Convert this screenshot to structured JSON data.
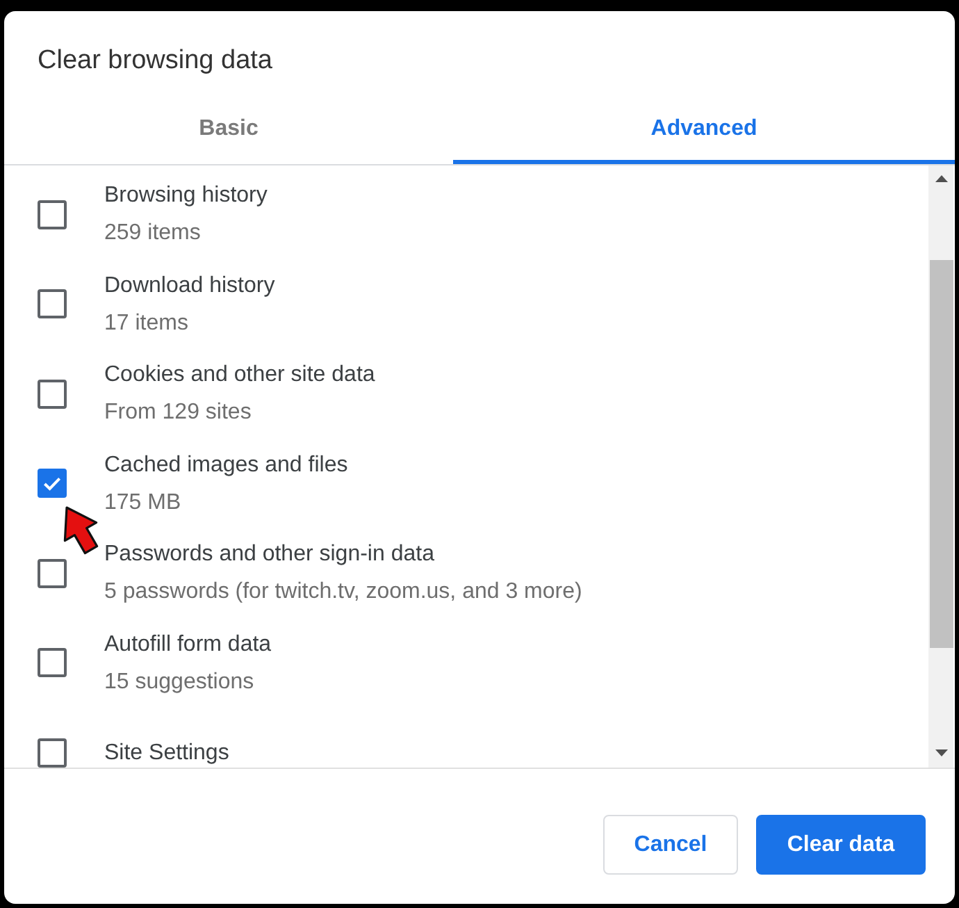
{
  "dialog": {
    "title": "Clear browsing data"
  },
  "tabs": [
    {
      "label": "Basic",
      "selected": false
    },
    {
      "label": "Advanced",
      "selected": true
    }
  ],
  "items": [
    {
      "label": "Browsing history",
      "detail": "259 items",
      "checked": false,
      "arrow_pointer": false
    },
    {
      "label": "Download history",
      "detail": "17 items",
      "checked": false,
      "arrow_pointer": false
    },
    {
      "label": "Cookies and other site data",
      "detail": "From 129 sites",
      "checked": false,
      "arrow_pointer": false
    },
    {
      "label": "Cached images and files",
      "detail": "175 MB",
      "checked": true,
      "arrow_pointer": true
    },
    {
      "label": "Passwords and other sign-in data",
      "detail": "5 passwords (for twitch.tv, zoom.us, and 3 more)",
      "checked": false,
      "arrow_pointer": false
    },
    {
      "label": "Autofill form data",
      "detail": "15 suggestions",
      "checked": false,
      "arrow_pointer": false
    },
    {
      "label": "Site Settings",
      "checked": false,
      "arrow_pointer": false
    }
  ],
  "buttons": [
    {
      "label": "Cancel",
      "kind": "cancel"
    },
    {
      "label": "Clear data",
      "kind": "confirm"
    }
  ]
}
